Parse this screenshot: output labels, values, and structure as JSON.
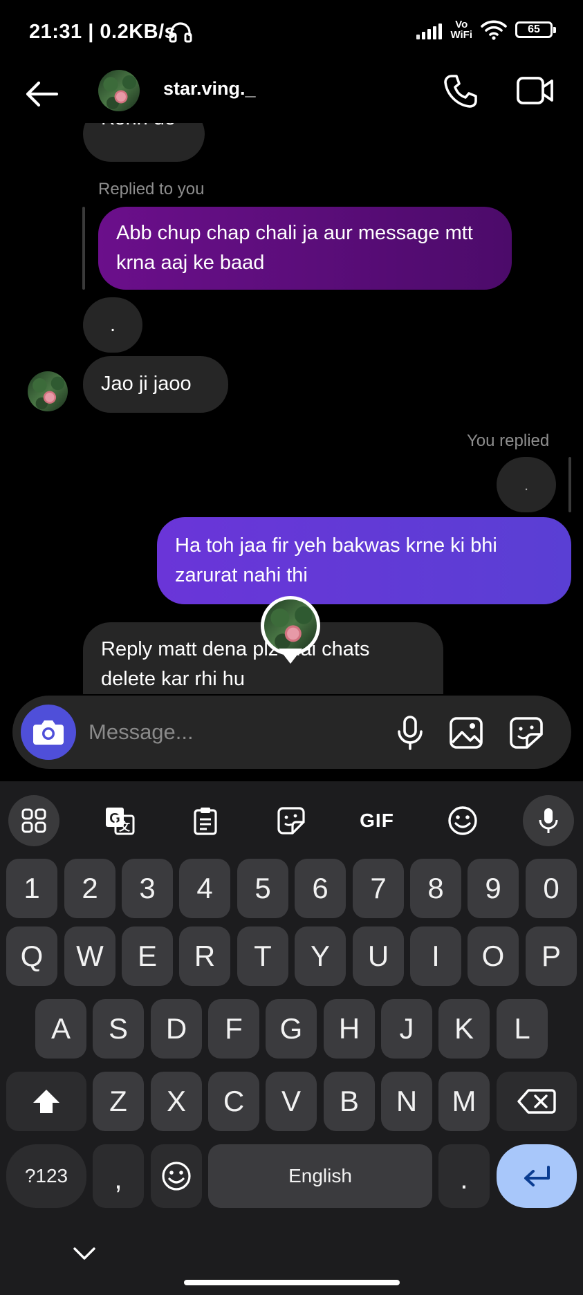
{
  "status_bar": {
    "time": "21:31 | 0.2KB/s",
    "network": "Vo WiFi",
    "battery": "65"
  },
  "header": {
    "username": "star.ving._"
  },
  "chat": {
    "partial_message": "Kehn do",
    "replied_to_you_label": "Replied to you",
    "sent_message_1": "Abb chup chap chali ja aur message mtt krna aaj ke baad",
    "dot_message_1": ".",
    "received_message_1": "Jao ji jaoo",
    "you_replied_label": "You replied",
    "dot_message_2": ".",
    "sent_message_2": "Ha toh jaa fir yeh bakwas krne ki bhi zarurat nahi thi",
    "received_message_2": "Reply matt dena plz mai chats delete kar rhi hu"
  },
  "composer": {
    "placeholder": "Message..."
  },
  "keyboard": {
    "toolbar": [
      "apps-grid",
      "translate",
      "clipboard",
      "sticker",
      "GIF",
      "emoji",
      "voice"
    ],
    "gif_label": "GIF",
    "row_numbers": [
      "1",
      "2",
      "3",
      "4",
      "5",
      "6",
      "7",
      "8",
      "9",
      "0"
    ],
    "row_1": [
      "Q",
      "W",
      "E",
      "R",
      "T",
      "Y",
      "U",
      "I",
      "O",
      "P"
    ],
    "row_2": [
      "A",
      "S",
      "D",
      "F",
      "G",
      "H",
      "J",
      "K",
      "L"
    ],
    "row_3": [
      "Z",
      "X",
      "C",
      "V",
      "B",
      "N",
      "M"
    ],
    "symbols_key": "?123",
    "comma_key": ",",
    "space_key": "English",
    "period_key": "."
  }
}
